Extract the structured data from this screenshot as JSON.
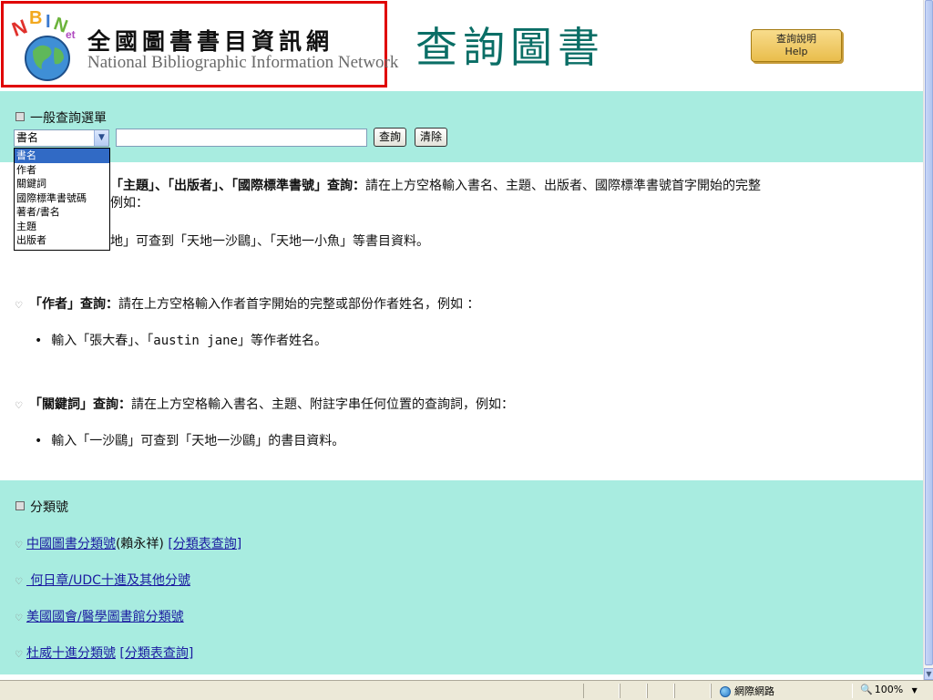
{
  "header": {
    "logo_title_zh": "全國圖書書目資訊網",
    "logo_title_en": "National Bibliographic Information Network",
    "page_title": "查詢圖書",
    "help_button": {
      "line1": "查詢說明",
      "line2": "Help"
    }
  },
  "search": {
    "section_label": "一般查詢選單",
    "selected_field": "書名",
    "input_value": "",
    "query_button": "查詢",
    "clear_button": "清除",
    "field_options": [
      "書名",
      "作者",
      "關鍵詞",
      "國際標準書號碼",
      "著者/書名",
      "主題",
      "出版者"
    ]
  },
  "help_text": {
    "para1_bold": "「主題」、「出版者」、「國際標準書號」查詢：",
    "para1_text": "請在上方空格輸入書名、主題、出版者、國際標準書號首字開始的完整",
    "para1_line2": "例如：",
    "para1_example": "地」可查到「天地一沙鷗」、「天地一小魚」等書目資料。",
    "para2_bold": "「作者」查詢：",
    "para2_text": "請在上方空格輸入作者首字開始的完整或部份作者姓名，例如 ：",
    "para2_example_prefix": "輸入「張大春」、「",
    "para2_example_latin": "austin jane",
    "para2_example_suffix": "」等作者姓名。",
    "para3_bold": "「關鍵詞」查詢：",
    "para3_text": "請在上方空格輸入書名、主題、附註字串任何位置的查詢詞，例如：",
    "para3_example": "輸入「一沙鷗」可查到「天地一沙鷗」的書目資料。"
  },
  "classification": {
    "section_label": "分類號",
    "links": [
      {
        "text": "中國圖書分類號",
        "middle": "(賴永祥) ",
        "extra": "[分類表查詢]"
      },
      {
        "text": " 何日章/UDC十進及其他分號",
        "middle": "",
        "extra": ""
      },
      {
        "text": "美國國會/醫學圖書館分類號",
        "middle": "",
        "extra": ""
      },
      {
        "text": "杜威十進分類號",
        "middle": " ",
        "extra": "[分類表查詢]"
      }
    ]
  },
  "statusbar": {
    "zone": "網際網路",
    "zoom": "100%"
  }
}
